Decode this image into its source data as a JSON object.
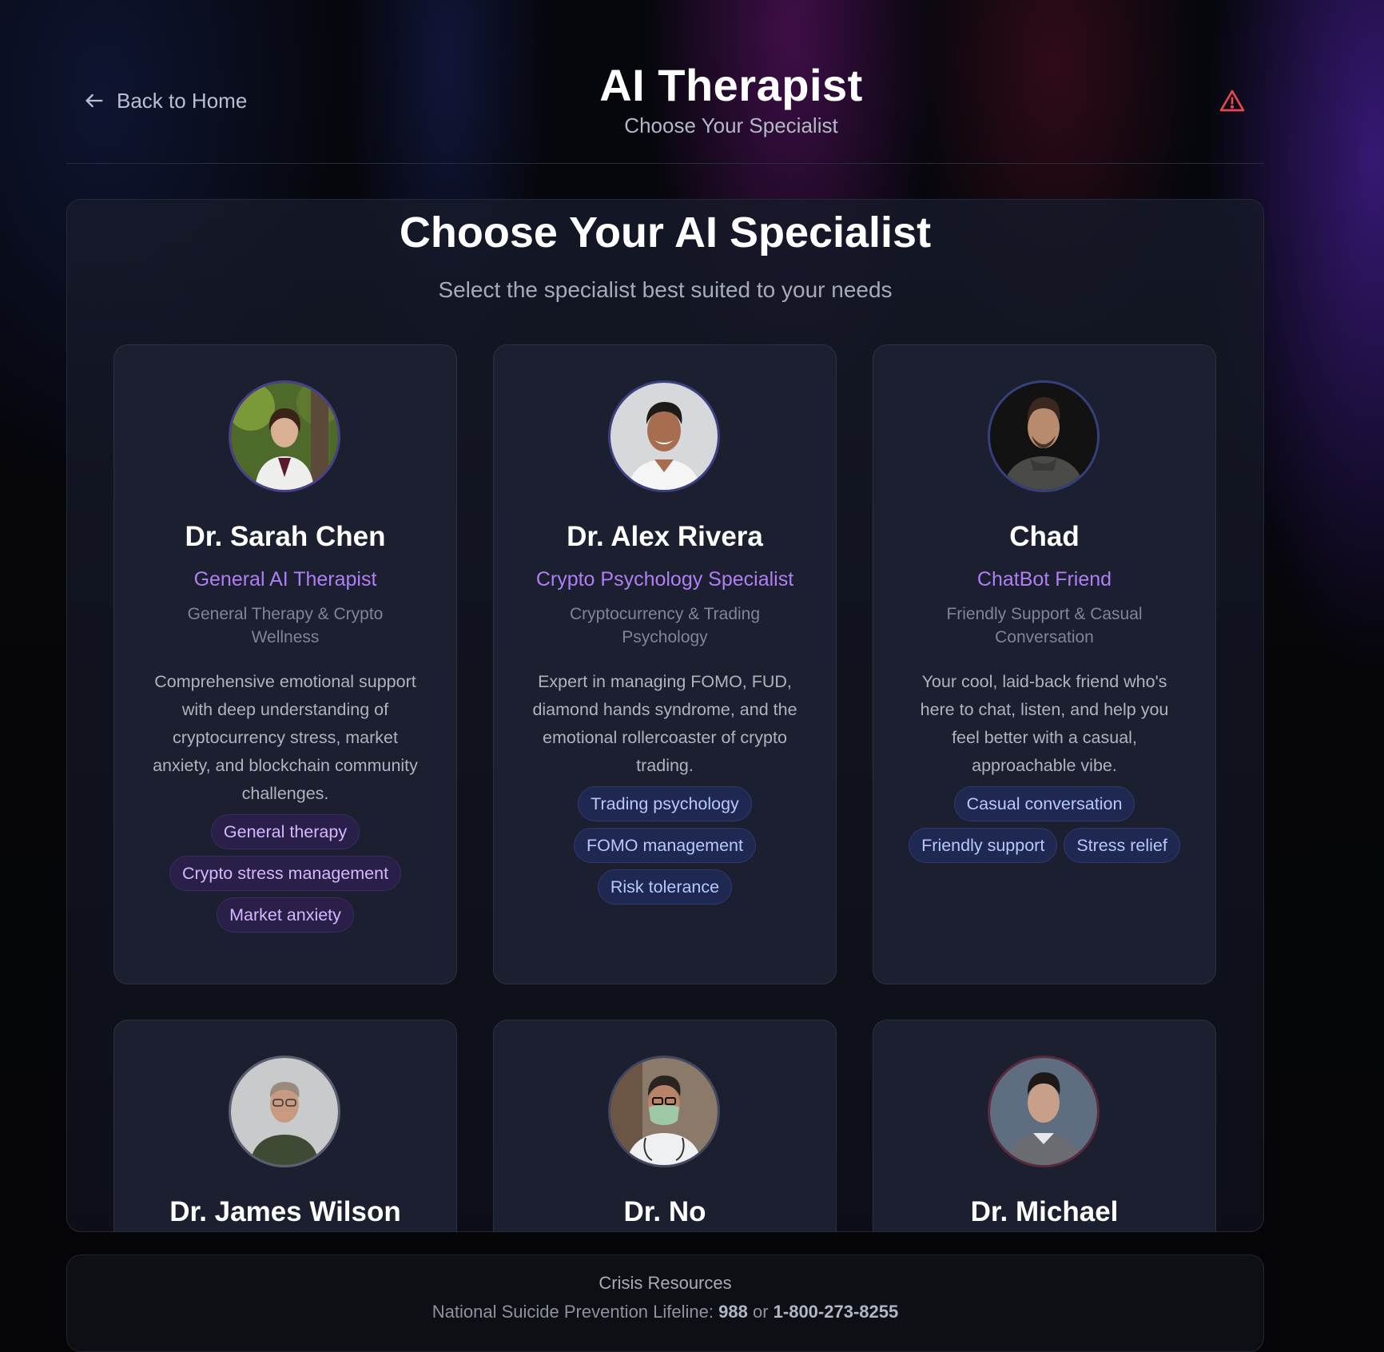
{
  "header": {
    "back_label": "Back to Home",
    "title": "AI Therapist",
    "subtitle": "Choose Your Specialist",
    "alert_icon": "warning-triangle-icon",
    "alert_color": "#e5484d"
  },
  "main": {
    "title": "Choose Your AI Specialist",
    "subtitle": "Select the specialist best suited to your needs"
  },
  "specialists": [
    {
      "name": "Dr. Sarah Chen",
      "role": "General AI Therapist",
      "focus": "General Therapy & Crypto Wellness",
      "description": "Comprehensive emotional support with deep understanding of cryptocurrency stress, market anxiety, and blockchain community challenges.",
      "tags": [
        "General therapy",
        "Crypto stress management",
        "Market anxiety"
      ],
      "tag_style": "purple"
    },
    {
      "name": "Dr. Alex Rivera",
      "role": "Crypto Psychology Specialist",
      "focus": "Cryptocurrency & Trading Psychology",
      "description": "Expert in managing FOMO, FUD, diamond hands syndrome, and the emotional rollercoaster of crypto trading.",
      "tags": [
        "Trading psychology",
        "FOMO management",
        "Risk tolerance"
      ],
      "tag_style": "blue"
    },
    {
      "name": "Chad",
      "role": "ChatBot Friend",
      "focus": "Friendly Support & Casual Conversation",
      "description": "Your cool, laid-back friend who's here to chat, listen, and help you feel better with a casual, approachable vibe.",
      "tags": [
        "Casual conversation",
        "Friendly support",
        "Stress relief"
      ],
      "tag_style": "blue"
    },
    {
      "name": "Dr. James Wilson"
    },
    {
      "name": "Dr. No"
    },
    {
      "name": "Dr. Michael"
    }
  ],
  "crisis": {
    "title": "Crisis Resources",
    "line_prefix": "National Suicide Prevention Lifeline:",
    "number_1": "988",
    "or": "or",
    "number_2": "1-800-273-8255"
  }
}
